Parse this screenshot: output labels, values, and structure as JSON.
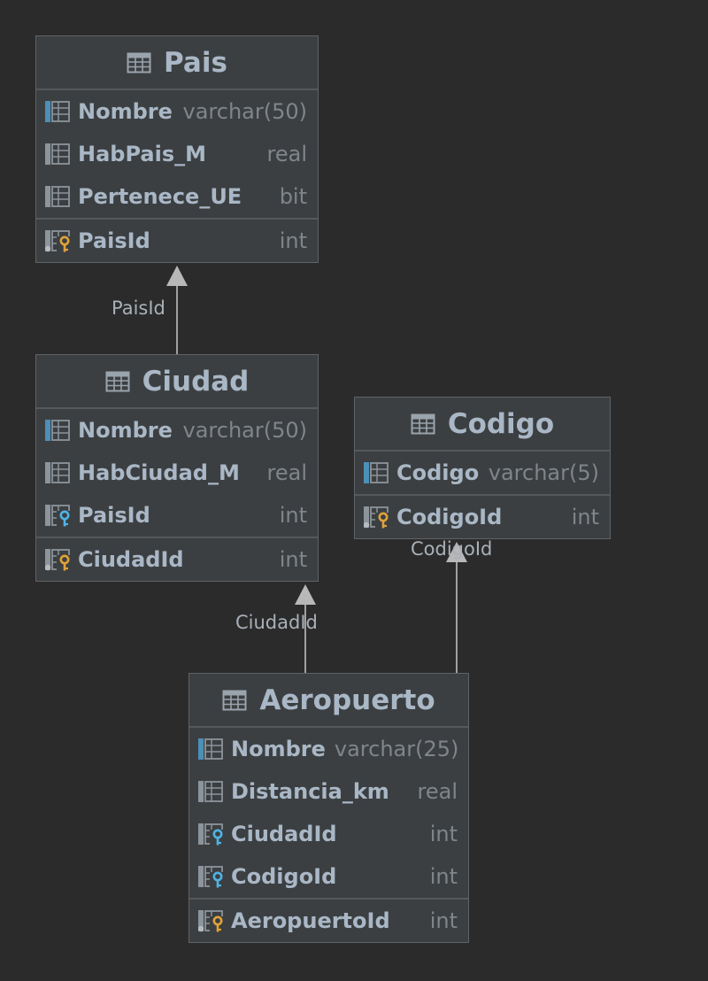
{
  "tables": {
    "pais": {
      "name": "Pais",
      "columns": [
        {
          "name": "Nombre",
          "type": "varchar(50)",
          "icon": "column-icon"
        },
        {
          "name": "HabPais_M",
          "type": "real",
          "icon": "column-icon"
        },
        {
          "name": "Pertenece_UE",
          "type": "bit",
          "icon": "column-icon"
        }
      ],
      "primary_key": {
        "name": "PaisId",
        "type": "int",
        "icon": "primary-key-icon"
      }
    },
    "ciudad": {
      "name": "Ciudad",
      "columns": [
        {
          "name": "Nombre",
          "type": "varchar(50)",
          "icon": "column-icon"
        },
        {
          "name": "HabCiudad_M",
          "type": "real",
          "icon": "column-icon"
        },
        {
          "name": "PaisId",
          "type": "int",
          "icon": "foreign-key-icon"
        }
      ],
      "primary_key": {
        "name": "CiudadId",
        "type": "int",
        "icon": "primary-key-icon"
      }
    },
    "codigo": {
      "name": "Codigo",
      "columns": [
        {
          "name": "Codigo",
          "type": "varchar(5)",
          "icon": "column-icon"
        }
      ],
      "primary_key": {
        "name": "CodigoId",
        "type": "int",
        "icon": "primary-key-icon"
      }
    },
    "aeropuerto": {
      "name": "Aeropuerto",
      "columns": [
        {
          "name": "Nombre",
          "type": "varchar(25)",
          "icon": "column-icon"
        },
        {
          "name": "Distancia_km",
          "type": "real",
          "icon": "column-icon"
        },
        {
          "name": "CiudadId",
          "type": "int",
          "icon": "foreign-key-icon"
        },
        {
          "name": "CodigoId",
          "type": "int",
          "icon": "foreign-key-icon"
        }
      ],
      "primary_key": {
        "name": "AeropuertoId",
        "type": "int",
        "icon": "primary-key-icon"
      }
    }
  },
  "relations": {
    "ciudad_pais": {
      "label": "PaisId",
      "from": "Ciudad",
      "to": "Pais"
    },
    "aeropuerto_ciudad": {
      "label": "CiudadId",
      "from": "Aeropuerto",
      "to": "Ciudad"
    },
    "aeropuerto_codigo": {
      "label": "CodigoId",
      "from": "Aeropuerto",
      "to": "Codigo"
    }
  },
  "colors": {
    "background": "#2b2b2b",
    "table_fill": "#3c3f41",
    "column_name": "#a9b7c6",
    "column_type": "#7f858b",
    "edge": "#a0a0a0",
    "key_gold": "#e0a23a",
    "key_blue": "#4fb3e6"
  }
}
